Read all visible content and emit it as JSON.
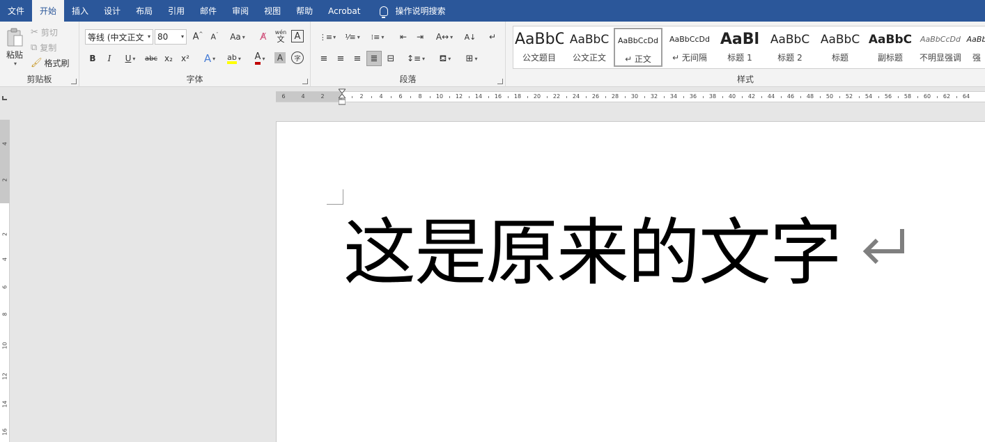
{
  "menu": {
    "tabs": [
      "文件",
      "开始",
      "插入",
      "设计",
      "布局",
      "引用",
      "邮件",
      "审阅",
      "视图",
      "帮助",
      "Acrobat"
    ],
    "active_index": 1,
    "tell_me": "操作说明搜索"
  },
  "clipboard": {
    "paste": "粘贴",
    "cut": "剪切",
    "copy": "复制",
    "format_painter": "格式刷",
    "label": "剪贴板"
  },
  "font": {
    "name": "等线 (中文正文",
    "size": "80",
    "change_case": "Aa",
    "label": "字体",
    "bold": "B",
    "italic": "I",
    "underline": "U",
    "strike": "abc",
    "subscript": "x₂",
    "superscript": "x²",
    "phonetic": "wén",
    "enclose": "字"
  },
  "paragraph": {
    "label": "段落"
  },
  "styles": {
    "label": "样式",
    "items": [
      {
        "preview": "AaBbC",
        "name": "公文题目"
      },
      {
        "preview": "AaBbC",
        "name": "公文正文"
      },
      {
        "preview": "AaBbCcDd",
        "name": "↵ 正文"
      },
      {
        "preview": "AaBbCcDd",
        "name": "↵ 无间隔"
      },
      {
        "preview": "AaBl",
        "name": "标题 1"
      },
      {
        "preview": "AaBbC",
        "name": "标题 2"
      },
      {
        "preview": "AaBbC",
        "name": "标题"
      },
      {
        "preview": "AaBbC",
        "name": "副标题"
      },
      {
        "preview": "AaBbCcDd",
        "name": "不明显强调"
      },
      {
        "preview": "AaBb",
        "name": "强"
      }
    ]
  },
  "ruler": {
    "left_labels": [
      "6",
      "4",
      "2"
    ],
    "right_labels": [
      "2",
      "4",
      "6",
      "8",
      "10",
      "12",
      "14",
      "16",
      "18",
      "20",
      "22",
      "24",
      "26",
      "28",
      "30",
      "32",
      "34",
      "36",
      "38",
      "40",
      "42",
      "44",
      "46",
      "48",
      "50",
      "52",
      "54",
      "56",
      "58",
      "60",
      "62",
      "64"
    ],
    "vertical_labels": [
      "4",
      "2",
      "2",
      "4",
      "6",
      "8",
      "10",
      "12",
      "14",
      "16"
    ]
  },
  "document": {
    "text": "这是原来的文字"
  }
}
